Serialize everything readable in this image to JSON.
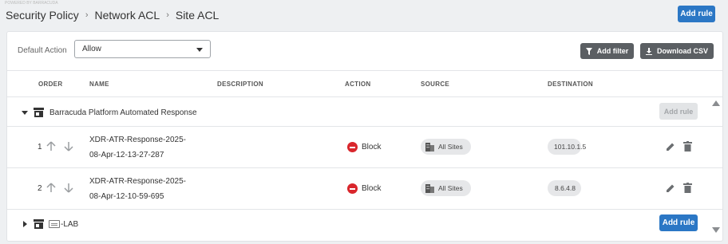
{
  "header": {
    "tiny_label": "POWERED BY BARRACUDA",
    "breadcrumb": [
      "Security Policy",
      "Network ACL",
      "Site ACL"
    ],
    "separator": "›",
    "add_rule_label": "Add rule"
  },
  "toolbar": {
    "default_action_label": "Default Action",
    "default_action_value": "Allow",
    "add_filter_label": "Add filter",
    "download_csv_label": "Download CSV"
  },
  "table": {
    "columns": [
      "ORDER",
      "NAME",
      "DESCRIPTION",
      "ACTION",
      "SOURCE",
      "DESTINATION"
    ]
  },
  "groups": [
    {
      "name": "Barracuda Platform Automated Response",
      "expanded": true,
      "add_rule_label": "Add rule",
      "add_rule_enabled": false,
      "rules": [
        {
          "order": "1",
          "name_line1": "XDR-ATR-Response-2025-",
          "name_line2": "08-Apr-12-13-27-287",
          "description": "",
          "action": "Block",
          "source": "All Sites",
          "destination": "101.10.1.5"
        },
        {
          "order": "2",
          "name_line1": "XDR-ATR-Response-2025-",
          "name_line2": "08-Apr-12-10-59-695",
          "description": "",
          "action": "Block",
          "source": "All Sites",
          "destination": "8.6.4.8"
        }
      ]
    },
    {
      "name": "-LAB",
      "expanded": false,
      "add_rule_label": "Add rule",
      "add_rule_enabled": true,
      "rules": []
    }
  ],
  "icons": {
    "filter": "filter-icon",
    "download": "download-icon",
    "store": "store-icon",
    "block": "block-icon",
    "sites": "building-icon",
    "edit": "pencil-icon",
    "delete": "trash-icon",
    "move_up": "arrow-up-icon",
    "move_down": "arrow-down-icon"
  },
  "colors": {
    "primary": "#2b77c5",
    "dark_button": "#5b5f63",
    "block_red": "#d9262c",
    "chip_bg": "#e6e7e9"
  }
}
